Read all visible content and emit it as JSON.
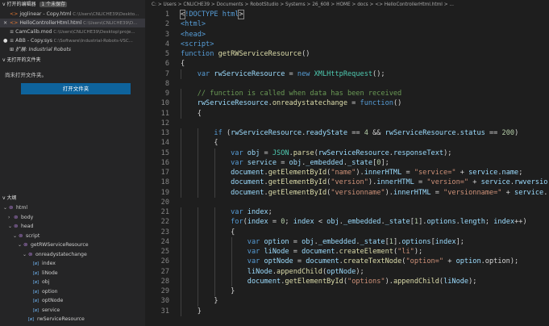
{
  "open_editors": {
    "title": "打开的编辑器",
    "badge": "1 个未保存",
    "items": [
      {
        "name": "jqglinear - Copy.html",
        "path": "C:\\Users\\CNLICHE39\\Deskto...",
        "icon": "html-icon",
        "prefix": ""
      },
      {
        "name": "HelloControllerHtml.html",
        "path": "C:\\Users\\CNLICHE39\\D...",
        "icon": "html-icon",
        "prefix": "×"
      },
      {
        "name": "CamCalib.mod",
        "path": "C:\\Users\\CNLICHE39\\Desktop\\proje...",
        "icon": "file-icon",
        "prefix": ""
      },
      {
        "name": "ABB - Copy.sys",
        "path": "C:\\Software\\Industrial-Robots-VSC...",
        "icon": "file-icon",
        "prefix": "●"
      },
      {
        "name": "扩展: Industrial Robots",
        "path": "",
        "icon": "extension-icon",
        "prefix": ""
      }
    ]
  },
  "no_folder": {
    "title": "无打开的文件夹",
    "message": "尚未打开文件夹。",
    "button": "打开文件夹"
  },
  "outline": {
    "title": "大纲",
    "items": [
      {
        "label": "html",
        "depth": 0,
        "chev": "v",
        "kind": "sym"
      },
      {
        "label": "body",
        "depth": 1,
        "chev": ">",
        "kind": "sym"
      },
      {
        "label": "head",
        "depth": 1,
        "chev": "v",
        "kind": "sym"
      },
      {
        "label": "script",
        "depth": 2,
        "chev": "v",
        "kind": "sym"
      },
      {
        "label": "getRWServiceResource",
        "depth": 3,
        "chev": "v",
        "kind": "sym"
      },
      {
        "label": "onreadystatechange",
        "depth": 4,
        "chev": "v",
        "kind": "sym"
      },
      {
        "label": "index",
        "depth": 5,
        "chev": "",
        "kind": "var"
      },
      {
        "label": "liNode",
        "depth": 5,
        "chev": "",
        "kind": "var"
      },
      {
        "label": "obj",
        "depth": 5,
        "chev": "",
        "kind": "var"
      },
      {
        "label": "option",
        "depth": 5,
        "chev": "",
        "kind": "var"
      },
      {
        "label": "optNode",
        "depth": 5,
        "chev": "",
        "kind": "var"
      },
      {
        "label": "service",
        "depth": 5,
        "chev": "",
        "kind": "var"
      },
      {
        "label": "rwServiceResource",
        "depth": 4,
        "chev": "",
        "kind": "var"
      }
    ]
  },
  "breadcrumb": "C: > Users > CNLICHE39 > Documents > RobotStudio > Systems > 26_608 > HOME > docs > <> HelloControllerHtml.html > ...",
  "code": [
    {
      "n": "1",
      "indent": 0,
      "tokens": [
        [
          "brk",
          "<"
        ],
        [
          "tag",
          "!DOCTYPE"
        ],
        [
          "",
          ""
        ],
        [
          "tag",
          " html"
        ],
        [
          "brk",
          ">"
        ]
      ]
    },
    {
      "n": "2",
      "indent": 0,
      "tokens": [
        [
          "tag",
          "<html>"
        ]
      ]
    },
    {
      "n": "3",
      "indent": 0,
      "tokens": [
        [
          "tag",
          "<head>"
        ]
      ]
    },
    {
      "n": "4",
      "indent": 0,
      "tokens": [
        [
          "tag",
          "<script>"
        ]
      ]
    },
    {
      "n": "5",
      "indent": 0,
      "tokens": [
        [
          "kw",
          "function "
        ],
        [
          "fn",
          "getRWServiceResource"
        ],
        [
          "",
          "()"
        ]
      ]
    },
    {
      "n": "6",
      "indent": 0,
      "tokens": [
        [
          "",
          "{"
        ]
      ]
    },
    {
      "n": "7",
      "indent": 1,
      "tokens": [
        [
          "kw",
          "var "
        ],
        [
          "var",
          "rwServiceResource"
        ],
        [
          "",
          " = "
        ],
        [
          "kw",
          "new "
        ],
        [
          "cls",
          "XMLHttpRequest"
        ],
        [
          "",
          "();"
        ]
      ]
    },
    {
      "n": "8",
      "indent": 0,
      "tokens": [
        [
          "",
          ""
        ]
      ]
    },
    {
      "n": "9",
      "indent": 1,
      "tokens": [
        [
          "cmt",
          "// function is called when data has been received"
        ]
      ]
    },
    {
      "n": "10",
      "indent": 1,
      "tokens": [
        [
          "var",
          "rwServiceResource"
        ],
        [
          "",
          "."
        ],
        [
          "fn",
          "onreadystatechange"
        ],
        [
          "",
          " = "
        ],
        [
          "kw",
          "function"
        ],
        [
          "",
          "()"
        ]
      ]
    },
    {
      "n": "11",
      "indent": 1,
      "tokens": [
        [
          "",
          "{"
        ]
      ]
    },
    {
      "n": "12",
      "indent": 0,
      "tokens": [
        [
          "",
          ""
        ]
      ]
    },
    {
      "n": "13",
      "indent": 2,
      "tokens": [
        [
          "kw",
          "if "
        ],
        [
          "",
          "("
        ],
        [
          "var",
          "rwServiceResource"
        ],
        [
          "",
          "."
        ],
        [
          "var",
          "readyState"
        ],
        [
          "",
          " == "
        ],
        [
          "num",
          "4"
        ],
        [
          "",
          " && "
        ],
        [
          "var",
          "rwServiceResource"
        ],
        [
          "",
          "."
        ],
        [
          "var",
          "status"
        ],
        [
          "",
          " == "
        ],
        [
          "num",
          "200"
        ],
        [
          "",
          ")"
        ]
      ]
    },
    {
      "n": "14",
      "indent": 2,
      "tokens": [
        [
          "",
          "{"
        ]
      ]
    },
    {
      "n": "15",
      "indent": 3,
      "tokens": [
        [
          "kw",
          "var "
        ],
        [
          "var",
          "obj"
        ],
        [
          "",
          " = "
        ],
        [
          "cls",
          "JSON"
        ],
        [
          "",
          "."
        ],
        [
          "fn",
          "parse"
        ],
        [
          "",
          "("
        ],
        [
          "var",
          "rwServiceResource"
        ],
        [
          "",
          "."
        ],
        [
          "var",
          "responseText"
        ],
        [
          "",
          ");"
        ]
      ]
    },
    {
      "n": "16",
      "indent": 3,
      "tokens": [
        [
          "kw",
          "var "
        ],
        [
          "var",
          "service"
        ],
        [
          "",
          " = "
        ],
        [
          "var",
          "obj"
        ],
        [
          "",
          "."
        ],
        [
          "var",
          "_embedded"
        ],
        [
          "",
          "."
        ],
        [
          "var",
          "_state"
        ],
        [
          "",
          "["
        ],
        [
          "num",
          "0"
        ],
        [
          "",
          "];"
        ]
      ]
    },
    {
      "n": "17",
      "indent": 3,
      "tokens": [
        [
          "var",
          "document"
        ],
        [
          "",
          "."
        ],
        [
          "fn",
          "getElementById"
        ],
        [
          "",
          "("
        ],
        [
          "str",
          "\"name\""
        ],
        [
          "",
          ")."
        ],
        [
          "var",
          "innerHTML"
        ],
        [
          "",
          " = "
        ],
        [
          "str",
          "\"service=\""
        ],
        [
          "",
          " + "
        ],
        [
          "var",
          "service"
        ],
        [
          "",
          "."
        ],
        [
          "var",
          "name"
        ],
        [
          "",
          ";"
        ]
      ]
    },
    {
      "n": "18",
      "indent": 3,
      "tokens": [
        [
          "var",
          "document"
        ],
        [
          "",
          "."
        ],
        [
          "fn",
          "getElementById"
        ],
        [
          "",
          "("
        ],
        [
          "str",
          "\"version\""
        ],
        [
          "",
          ")."
        ],
        [
          "var",
          "innerHTML"
        ],
        [
          "",
          " = "
        ],
        [
          "str",
          "\"version=\""
        ],
        [
          "",
          " + "
        ],
        [
          "var",
          "service"
        ],
        [
          "",
          "."
        ],
        [
          "var",
          "rwversio"
        ]
      ]
    },
    {
      "n": "19",
      "indent": 3,
      "tokens": [
        [
          "var",
          "document"
        ],
        [
          "",
          "."
        ],
        [
          "fn",
          "getElementById"
        ],
        [
          "",
          "("
        ],
        [
          "str",
          "\"versionname\""
        ],
        [
          "",
          ")."
        ],
        [
          "var",
          "innerHTML"
        ],
        [
          "",
          " = "
        ],
        [
          "str",
          "\"versionname=\""
        ],
        [
          "",
          " + "
        ],
        [
          "var",
          "service"
        ],
        [
          "",
          "."
        ]
      ]
    },
    {
      "n": "20",
      "indent": 0,
      "tokens": [
        [
          "",
          ""
        ]
      ]
    },
    {
      "n": "21",
      "indent": 3,
      "tokens": [
        [
          "kw",
          "var "
        ],
        [
          "var",
          "index"
        ],
        [
          "",
          ";"
        ]
      ]
    },
    {
      "n": "22",
      "indent": 3,
      "tokens": [
        [
          "kw",
          "for"
        ],
        [
          "",
          "("
        ],
        [
          "var",
          "index"
        ],
        [
          "",
          " = "
        ],
        [
          "num",
          "0"
        ],
        [
          "",
          "; "
        ],
        [
          "var",
          "index"
        ],
        [
          "",
          " < "
        ],
        [
          "var",
          "obj"
        ],
        [
          "",
          "."
        ],
        [
          "var",
          "_embedded"
        ],
        [
          "",
          "."
        ],
        [
          "var",
          "_state"
        ],
        [
          "",
          "["
        ],
        [
          "num",
          "1"
        ],
        [
          "",
          "]."
        ],
        [
          "var",
          "options"
        ],
        [
          "",
          "."
        ],
        [
          "var",
          "length"
        ],
        [
          "",
          "; "
        ],
        [
          "var",
          "index"
        ],
        [
          "",
          "++)"
        ]
      ]
    },
    {
      "n": "23",
      "indent": 3,
      "tokens": [
        [
          "",
          "{"
        ]
      ]
    },
    {
      "n": "24",
      "indent": 4,
      "tokens": [
        [
          "kw",
          "var "
        ],
        [
          "var",
          "option"
        ],
        [
          "",
          " = "
        ],
        [
          "var",
          "obj"
        ],
        [
          "",
          "."
        ],
        [
          "var",
          "_embedded"
        ],
        [
          "",
          "."
        ],
        [
          "var",
          "_state"
        ],
        [
          "",
          "["
        ],
        [
          "num",
          "1"
        ],
        [
          "",
          "]."
        ],
        [
          "var",
          "options"
        ],
        [
          "",
          "["
        ],
        [
          "var",
          "index"
        ],
        [
          "",
          "];"
        ]
      ]
    },
    {
      "n": "25",
      "indent": 4,
      "tokens": [
        [
          "kw",
          "var "
        ],
        [
          "var",
          "liNode"
        ],
        [
          "",
          " = "
        ],
        [
          "var",
          "document"
        ],
        [
          "",
          "."
        ],
        [
          "fn",
          "createElement"
        ],
        [
          "",
          "("
        ],
        [
          "str",
          "\"li\""
        ],
        [
          "",
          ");"
        ]
      ]
    },
    {
      "n": "26",
      "indent": 4,
      "tokens": [
        [
          "kw",
          "var "
        ],
        [
          "var",
          "optNode"
        ],
        [
          "",
          " = "
        ],
        [
          "var",
          "document"
        ],
        [
          "",
          "."
        ],
        [
          "fn",
          "createTextNode"
        ],
        [
          "",
          "("
        ],
        [
          "str",
          "\"option=\""
        ],
        [
          "",
          " + "
        ],
        [
          "var",
          "option"
        ],
        [
          "",
          ".option);"
        ]
      ]
    },
    {
      "n": "27",
      "indent": 4,
      "tokens": [
        [
          "var",
          "liNode"
        ],
        [
          "",
          "."
        ],
        [
          "fn",
          "appendChild"
        ],
        [
          "",
          "("
        ],
        [
          "var",
          "optNode"
        ],
        [
          "",
          ");"
        ]
      ]
    },
    {
      "n": "28",
      "indent": 4,
      "tokens": [
        [
          "var",
          "document"
        ],
        [
          "",
          "."
        ],
        [
          "fn",
          "getElementById"
        ],
        [
          "",
          "("
        ],
        [
          "str",
          "\"options\""
        ],
        [
          "",
          ")."
        ],
        [
          "fn",
          "appendChild"
        ],
        [
          "",
          "("
        ],
        [
          "var",
          "liNode"
        ],
        [
          "",
          ");"
        ]
      ]
    },
    {
      "n": "29",
      "indent": 3,
      "tokens": [
        [
          "",
          "}"
        ]
      ]
    },
    {
      "n": "30",
      "indent": 2,
      "tokens": [
        [
          "",
          "}"
        ]
      ]
    },
    {
      "n": "31",
      "indent": 1,
      "tokens": [
        [
          "",
          "}"
        ]
      ]
    }
  ]
}
